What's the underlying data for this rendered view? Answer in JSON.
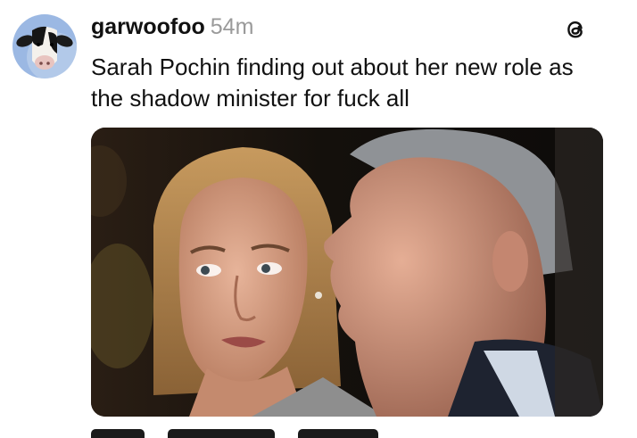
{
  "post": {
    "username": "garwoofoo",
    "timestamp": "54m",
    "text_line1": "Sarah Pochin finding out about her new role as",
    "text_line2": "the shadow minister for fuck all",
    "avatar_icon": "cow-avatar",
    "app_icon": "threads-icon",
    "media": "photo of a woman looking sideways at a man in profile"
  },
  "colors": {
    "text": "#111111",
    "timestamp": "#9a9a9a",
    "avatar_bg": "#9bb8e3"
  }
}
